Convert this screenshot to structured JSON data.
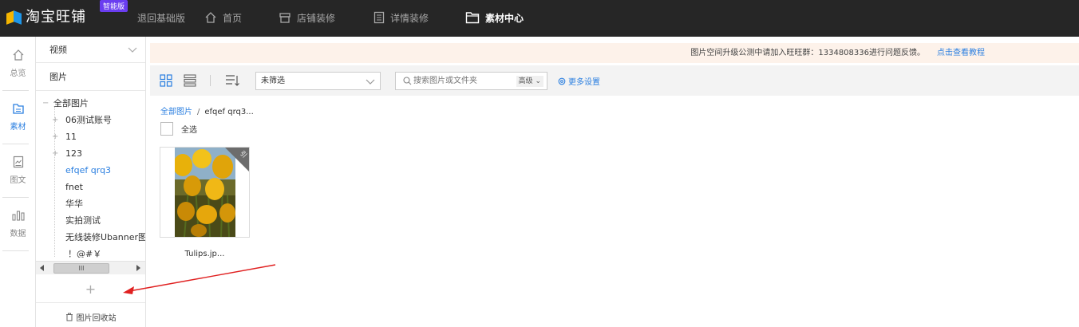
{
  "topbar": {
    "logo_text": "淘宝旺铺",
    "badge": "智能版",
    "back_link": "退回基础版",
    "nav": [
      {
        "label": "首页",
        "icon": "home-icon"
      },
      {
        "label": "店铺装修",
        "icon": "store-icon"
      },
      {
        "label": "详情装修",
        "icon": "document-icon"
      },
      {
        "label": "素材中心",
        "icon": "folder-icon",
        "active": true
      }
    ]
  },
  "rail": [
    {
      "label": "总览",
      "icon": "home-icon"
    },
    {
      "label": "素材",
      "icon": "material-icon",
      "active": true
    },
    {
      "label": "图文",
      "icon": "image-text-icon"
    },
    {
      "label": "数据",
      "icon": "bar-chart-icon"
    }
  ],
  "sidebar": {
    "video_label": "视频",
    "image_label": "图片",
    "tree": [
      {
        "label": "全部图片",
        "ctl": "−"
      },
      {
        "label": "06测试账号",
        "ctl": "+"
      },
      {
        "label": "11",
        "ctl": "+"
      },
      {
        "label": "123",
        "ctl": "+"
      },
      {
        "label": "efqef qrq3",
        "selected": true
      },
      {
        "label": "fnet"
      },
      {
        "label": "华华"
      },
      {
        "label": "实拍测试"
      },
      {
        "label": "无线装修Ubanner图片"
      },
      {
        "label": "！@#￥"
      }
    ],
    "scroll_thumb": "III",
    "add_label": "+",
    "recycle_label": "图片回收站"
  },
  "notice": {
    "text": "图片空间升级公测中请加入旺旺群：1334808336进行问题反馈。",
    "link": "点击查看教程"
  },
  "toolbar": {
    "filter_value": "未筛选",
    "search_placeholder": "搜索图片或文件夹",
    "advanced": "高级",
    "more_settings": "更多设置"
  },
  "breadcrumb": {
    "root": "全部图片",
    "separator": "/",
    "current": "efqef qrq3..."
  },
  "select_all": "全选",
  "files": [
    {
      "name": "Tulips.jp...",
      "corner_tag": "引"
    }
  ],
  "colors": {
    "topbar_bg": "#262626",
    "accent": "#2b7fe0",
    "notice_bg": "#fdf2ea",
    "arrow": "#e02020"
  }
}
